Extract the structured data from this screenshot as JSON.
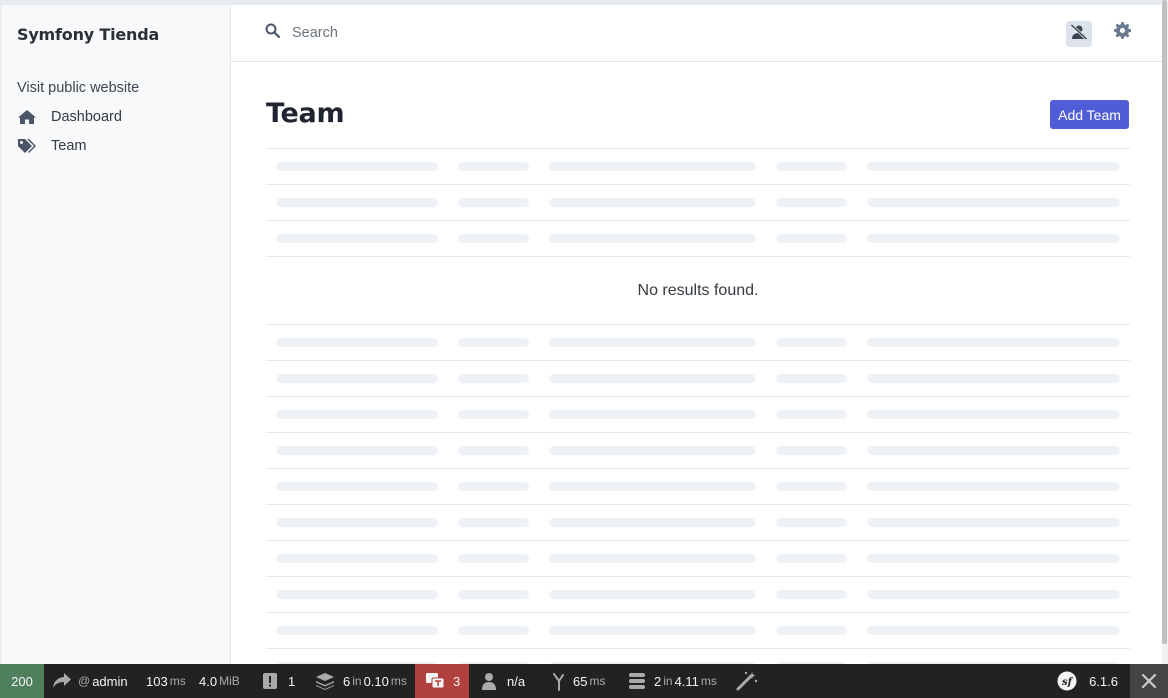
{
  "app": {
    "brand": "Symfony Tienda"
  },
  "sidebar": {
    "public_link": "Visit public website",
    "items": [
      {
        "label": "Dashboard",
        "icon": "home-icon"
      },
      {
        "label": "Team",
        "icon": "tags-icon"
      }
    ]
  },
  "topbar": {
    "search_placeholder": "Search"
  },
  "page": {
    "title": "Team",
    "add_button": "Add Team",
    "empty_message": "No results found."
  },
  "debug_toolbar": {
    "status_code": "200",
    "user_prefix": "@",
    "user": "admin",
    "time_value": "103",
    "time_unit": "ms",
    "memory_value": "4.0",
    "memory_unit": "MiB",
    "logs_count": "1",
    "cache_value": "6",
    "cache_in": "in",
    "cache_time": "0.10",
    "cache_unit": "ms",
    "translations_count": "3",
    "security": "n/a",
    "events_value": "65",
    "events_unit": "ms",
    "db_value": "2",
    "db_in": "in",
    "db_time": "4.11",
    "db_unit": "ms",
    "version": "6.1.6"
  },
  "colors": {
    "accent": "#4f5dd6",
    "status_ok": "#4f805d",
    "status_error": "#b0413e",
    "toolbar_bg": "#222222"
  }
}
